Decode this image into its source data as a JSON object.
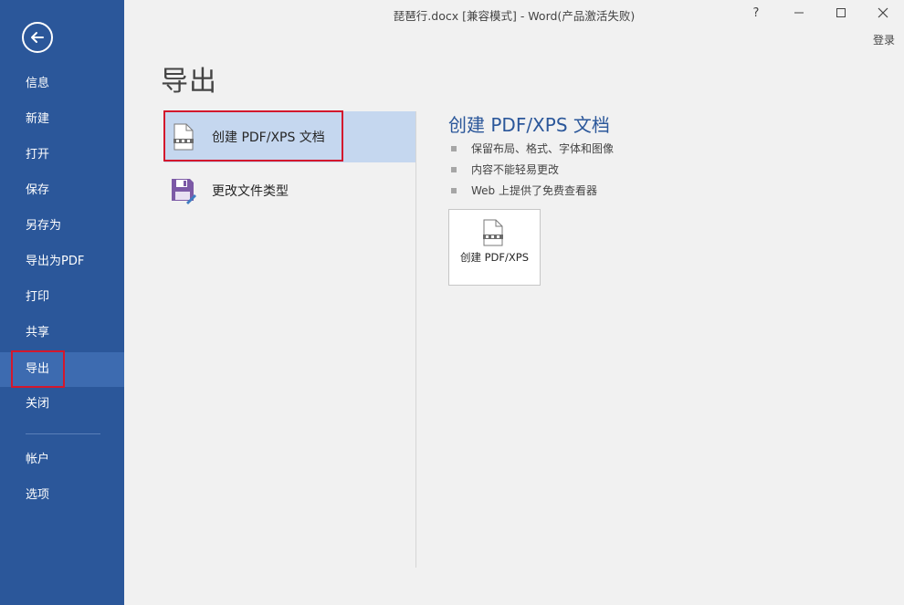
{
  "window": {
    "title": "琵琶行.docx [兼容模式] - Word(产品激活失败)",
    "help": "?",
    "minimize": "—",
    "maximize": "☐",
    "close": "✕",
    "login": "登录"
  },
  "sidebar": {
    "back_icon": "back-arrow-icon",
    "items": [
      {
        "label": "信息"
      },
      {
        "label": "新建"
      },
      {
        "label": "打开"
      },
      {
        "label": "保存"
      },
      {
        "label": "另存为"
      },
      {
        "label": "导出为PDF"
      },
      {
        "label": "打印"
      },
      {
        "label": "共享"
      },
      {
        "label": "导出",
        "active": true
      },
      {
        "label": "关闭"
      },
      {
        "label": "帐户"
      },
      {
        "label": "选项"
      }
    ]
  },
  "main": {
    "title": "导出",
    "options": [
      {
        "label": "创建 PDF/XPS 文档",
        "icon": "pdf-document-icon",
        "selected": true
      },
      {
        "label": "更改文件类型",
        "icon": "save-file-type-icon",
        "selected": false
      }
    ]
  },
  "detail": {
    "title": "创建 PDF/XPS 文档",
    "bullets": [
      "保留布局、格式、字体和图像",
      "内容不能轻易更改",
      "Web 上提供了免费查看器"
    ],
    "button_label": "创建 PDF/XPS",
    "button_icon": "pdf-document-icon"
  },
  "colors": {
    "sidebar": "#2b579a",
    "sidebar_active": "#3d6bb0",
    "selection": "#c5d7ef",
    "highlight_border": "#d3182d"
  }
}
